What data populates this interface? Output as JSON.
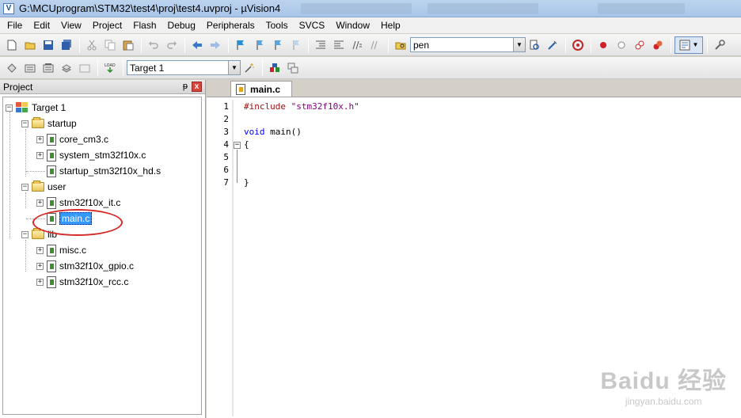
{
  "window": {
    "title": "G:\\MCUprogram\\STM32\\test4\\proj\\test4.uvproj - µVision4"
  },
  "menu": [
    "File",
    "Edit",
    "View",
    "Project",
    "Flash",
    "Debug",
    "Peripherals",
    "Tools",
    "SVCS",
    "Window",
    "Help"
  ],
  "toolbar": {
    "find_value": "pen",
    "target_value": "Target 1"
  },
  "project_panel": {
    "title": "Project",
    "pin_glyph": "ᵽ",
    "close_glyph": "x",
    "tree": {
      "target": "Target 1",
      "groups": [
        {
          "name": "startup",
          "files": [
            "core_cm3.c",
            "system_stm32f10x.c",
            "startup_stm32f10x_hd.s"
          ]
        },
        {
          "name": "user",
          "files": [
            "stm32f10x_it.c",
            "main.c"
          ]
        },
        {
          "name": "lib",
          "files": [
            "misc.c",
            "stm32f10x_gpio.c",
            "stm32f10x_rcc.c"
          ]
        }
      ],
      "selected": "main.c"
    }
  },
  "editor": {
    "tab": "main.c",
    "line_numbers": [
      "1",
      "2",
      "3",
      "4",
      "5",
      "6",
      "7"
    ],
    "lines": [
      {
        "pre": "#include",
        "str": " \"stm32f10x.h\""
      },
      {
        "text": ""
      },
      {
        "kw": "void",
        "text": " main()"
      },
      {
        "text": "{"
      },
      {
        "text": ""
      },
      {
        "text": ""
      },
      {
        "text": "}"
      }
    ]
  },
  "watermark": {
    "brand": "Baidu 经验",
    "url": "jingyan.baidu.com"
  },
  "colors": {
    "selection": "#3399ff",
    "annotation": "#d62a2a",
    "keyword": "#0000ff"
  }
}
